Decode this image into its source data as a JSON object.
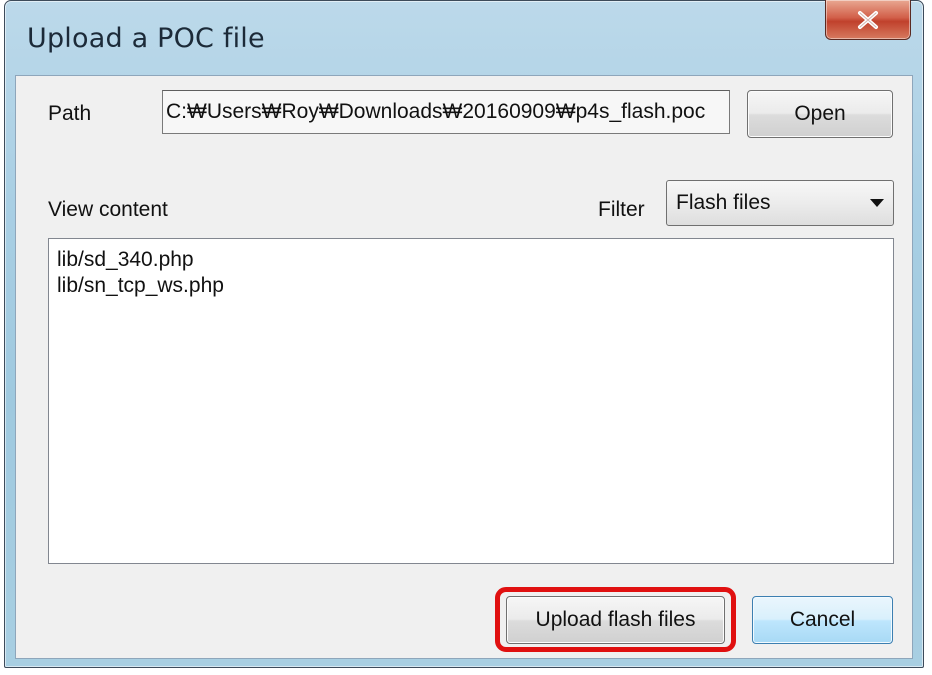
{
  "window": {
    "title": "Upload a POC file",
    "close_icon": "close-icon"
  },
  "path": {
    "label": "Path",
    "value": "C:₩Users₩Roy₩Downloads₩20160909₩p4s_flash.poc",
    "open_label": "Open"
  },
  "view": {
    "label": "View content",
    "filter_label": "Filter",
    "filter_value": "Flash files",
    "items": [
      "lib/sd_340.php",
      "lib/sn_tcp_ws.php"
    ]
  },
  "actions": {
    "upload_label": "Upload flash files",
    "cancel_label": "Cancel",
    "highlight_color": "#e01010"
  }
}
